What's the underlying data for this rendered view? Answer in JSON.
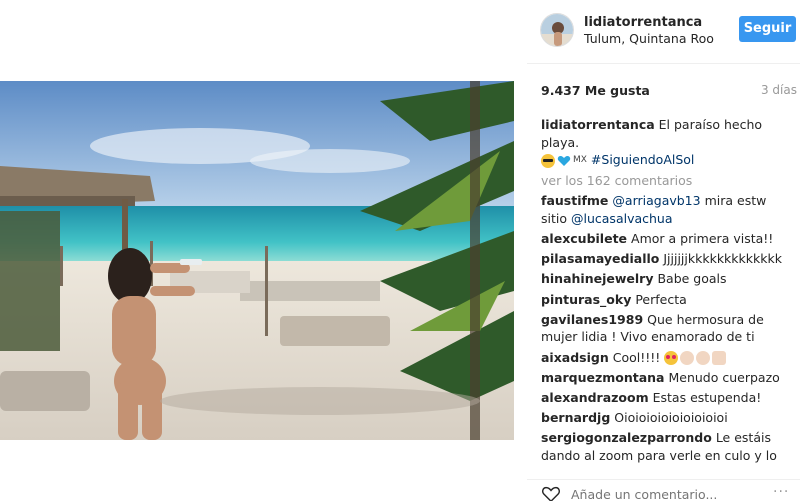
{
  "header": {
    "username": "lidiatorrentanca",
    "location": "Tulum, Quintana Roo",
    "follow_label": "Seguir"
  },
  "stats": {
    "likes": "9.437 Me gusta",
    "time_ago": "3 días"
  },
  "caption": {
    "user": "lidiatorrentanca",
    "text": "El paraíso hecho playa.",
    "country": "MX",
    "hashtag": "#SiguiendoAlSol"
  },
  "view_all": "ver los 162 comentarios",
  "comments": [
    {
      "user": "faustifme",
      "mention": "@arriagavb13",
      "text": "mira estw sitio",
      "mention2": "@lucasalvachua"
    },
    {
      "user": "alexcubilete",
      "text": "Amor a primera vista!!"
    },
    {
      "user": "pilasamayediallo",
      "text": "Jjjjjjjkkkkkkkkkkkkk"
    },
    {
      "user": "hinahinejewelry",
      "text": "Babe goals"
    },
    {
      "user": "pinturas_oky",
      "text": "Perfecta"
    },
    {
      "user": "gavilanes1989",
      "text": "Que hermosura de mujer lidia ! Vivo enamorado de ti"
    },
    {
      "user": "aixadsign",
      "text": "Cool!!!!"
    },
    {
      "user": "marquezmontana",
      "text": "Menudo cuerpazo"
    },
    {
      "user": "alexandrazoom",
      "text": "Estas estupenda!"
    },
    {
      "user": "bernardjg",
      "text": "Oioioioioioioioioioi"
    },
    {
      "user": "sergiogonzalezparrondo",
      "text": "Le estáis dando al zoom para verle en culo y lo"
    }
  ],
  "add_comment_placeholder": "Añade un comentario...",
  "more_label": "···",
  "icons": {
    "like": "heart-icon",
    "more": "more-options-icon"
  },
  "colors": {
    "accent": "#3897f0",
    "link": "#003569",
    "muted": "#999999"
  }
}
